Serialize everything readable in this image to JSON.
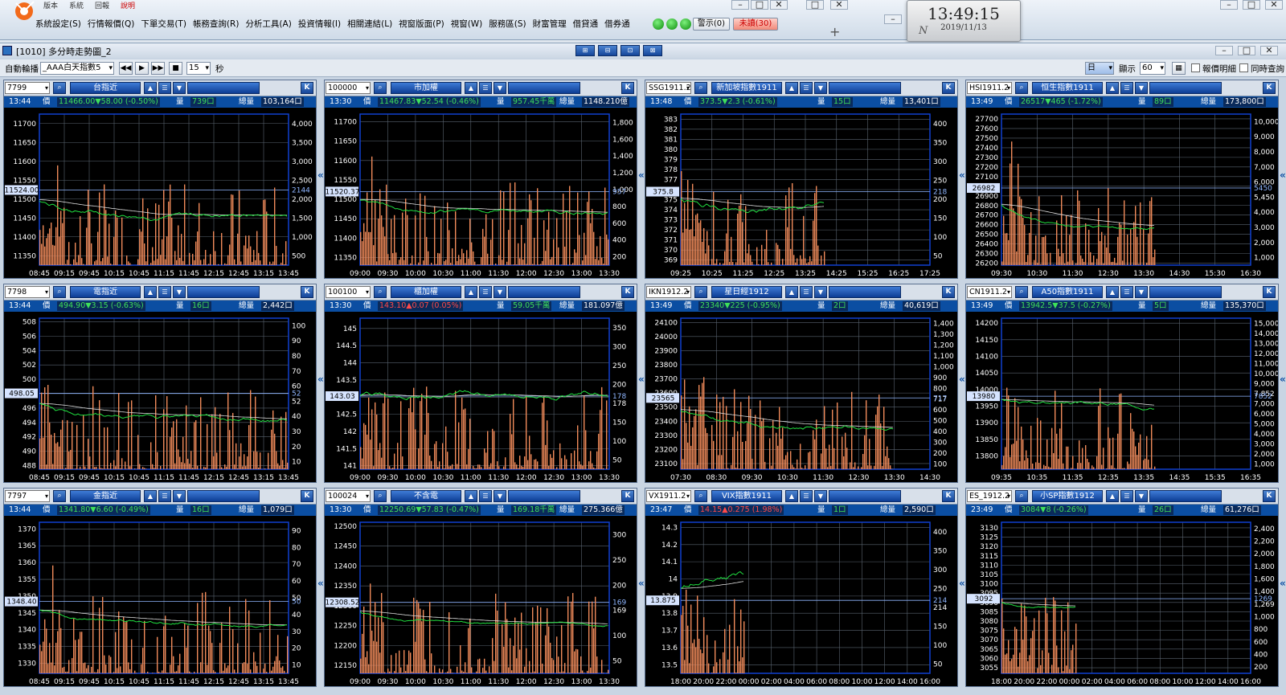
{
  "app": {
    "top_strip": [
      "版本",
      "系統",
      "回報",
      "說明"
    ],
    "menu": [
      "系統設定(S)",
      "行情報價(Q)",
      "下單交易(T)",
      "帳務查詢(R)",
      "分析工具(A)",
      "投資情報(I)",
      "相關連結(L)",
      "視窗版面(P)",
      "視窗(W)",
      "服務區(S)",
      "財富管理",
      "借貸通",
      "借券通"
    ],
    "alert_label": "警示(0)",
    "unread_label": "未讀(30)"
  },
  "clock": {
    "time": "13:49:15",
    "date": "2019/11/13",
    "mark": "N"
  },
  "window": {
    "title": "[1010] 多分時走勢圖_2",
    "title_buttons": [
      "⊞",
      "⊟",
      "⊡",
      "⊠"
    ]
  },
  "toolbar": {
    "auto_label": "自動輪播",
    "group": "_AAA白天指數5",
    "interval": "15",
    "sec": "秒",
    "period": "日",
    "display_label": "顯示",
    "display_value": "60",
    "opt1": "報價明細",
    "opt2": "同時查詢"
  },
  "labels": {
    "price": "價",
    "vol": "量",
    "total": "總量",
    "k": "K"
  },
  "panels": [
    {
      "code": "7799",
      "name": "台指近",
      "time": "13:44",
      "price": "11466.00▼58.00 (-0.50%)",
      "dir": "dn",
      "vol": "739口",
      "total": "103,164口",
      "yticks": [
        "11700",
        "11650",
        "11600",
        "11550",
        "11500",
        "11450",
        "11400",
        "11350"
      ],
      "ymin": 11325,
      "ymax": 11725,
      "vticks": [
        "4,000",
        "3,500",
        "3,000",
        "2,500",
        "2,000",
        "1,500",
        "1,000",
        "500"
      ],
      "vmax": 4200,
      "ref": "11524.00",
      "refv": 11524,
      "vref": "2144",
      "xticks": [
        "08:45",
        "09:15",
        "09:45",
        "10:15",
        "10:45",
        "11:15",
        "11:45",
        "12:15",
        "12:45",
        "13:15",
        "13:45"
      ],
      "fill": 1.0,
      "base": 11460,
      "amp": 25
    },
    {
      "code": "100000",
      "name": "市加權",
      "time": "13:30",
      "price": "11467.83▼52.54 (-0.46%)",
      "dir": "dn",
      "vol": "957.45千萬",
      "total": "1148.210億",
      "yticks": [
        "11700",
        "11650",
        "11600",
        "11550",
        "11500",
        "11450",
        "11400",
        "11350"
      ],
      "ymin": 11330,
      "ymax": 11720,
      "vticks": [
        "1,800",
        "1,600",
        "1,400",
        "1,200",
        "1,000",
        "800",
        "600",
        "400",
        "200"
      ],
      "vmax": 1900,
      "ref": "11520.37",
      "refv": 11520,
      "vref": "957",
      "xticks": [
        "09:00",
        "09:30",
        "10:00",
        "10:30",
        "11:00",
        "11:30",
        "12:00",
        "12:30",
        "13:00",
        "13:30"
      ],
      "fill": 1.0,
      "base": 11470,
      "amp": 20
    },
    {
      "code": "SSG1911.2",
      "name": "新加坡指數1911",
      "time": "13:48",
      "price": "373.5▼2.3 (-0.61%)",
      "dir": "dn",
      "vol": "15口",
      "total": "13,401口",
      "yticks": [
        "383",
        "382",
        "381",
        "380",
        "379",
        "378",
        "377",
        "376",
        "375",
        "374",
        "373",
        "372",
        "371",
        "370",
        "369"
      ],
      "ymin": 368.5,
      "ymax": 383.5,
      "vticks": [
        "400",
        "350",
        "300",
        "250",
        "200",
        "150",
        "100",
        "50"
      ],
      "vmax": 420,
      "ref": "375.8",
      "refv": 375.8,
      "vref": "218",
      "xticks": [
        "09:25",
        "10:25",
        "11:25",
        "12:25",
        "13:25",
        "14:25",
        "15:25",
        "16:25",
        "17:25"
      ],
      "fill": 0.58,
      "base": 374.2,
      "amp": 1.2
    },
    {
      "code": "HSI1911.2",
      "name": "恒生指數1911",
      "time": "13:49",
      "price": "26517▼465 (-1.72%)",
      "dir": "dn",
      "vol": "89口",
      "total": "173,800口",
      "yticks": [
        "27700",
        "27600",
        "27500",
        "27400",
        "27300",
        "27200",
        "27100",
        "27000",
        "26900",
        "26800",
        "26700",
        "26600",
        "26500",
        "26400",
        "26300",
        "26200"
      ],
      "ymin": 26180,
      "ymax": 27750,
      "vticks": [
        "10,000",
        "9,000",
        "8,000",
        "7,000",
        "6,000",
        "5,450",
        "4,000",
        "3,000",
        "2,000",
        "1,000"
      ],
      "vmax": 10500,
      "ref": "26982",
      "refv": 26982,
      "vref": "5450",
      "xticks": [
        "09:30",
        "10:30",
        "11:30",
        "12:30",
        "13:30",
        "14:30",
        "15:30",
        "16:30"
      ],
      "fill": 0.62,
      "base": 26560,
      "amp": 60
    },
    {
      "code": "7798",
      "name": "電指近",
      "time": "13:44",
      "price": "494.90▼3.15 (-0.63%)",
      "dir": "dn",
      "vol": "16口",
      "total": "2,442口",
      "yticks": [
        "508",
        "506",
        "504",
        "502",
        "500",
        "498",
        "496",
        "494",
        "492",
        "490",
        "488"
      ],
      "ymin": 487.5,
      "ymax": 508.5,
      "vticks": [
        "100",
        "90",
        "80",
        "70",
        "60",
        "52",
        "40",
        "30",
        "20",
        "10"
      ],
      "vmax": 105,
      "ref": "498.05",
      "refv": 498.05,
      "vref": "52",
      "xticks": [
        "08:45",
        "09:15",
        "09:45",
        "10:15",
        "10:45",
        "11:15",
        "11:45",
        "12:15",
        "12:45",
        "13:15",
        "13:45"
      ],
      "fill": 1.0,
      "base": 494.5,
      "amp": 1.2
    },
    {
      "code": "100100",
      "name": "櫃加權",
      "time": "13:30",
      "price": "143.10▲0.07 (0.05%)",
      "dir": "up",
      "vol": "59.05千萬",
      "total": "181.097億",
      "yticks": [
        "145",
        "144.5",
        "144",
        "143.5",
        "143",
        "142.5",
        "142",
        "141.5",
        "141"
      ],
      "ymin": 140.9,
      "ymax": 145.3,
      "vticks": [
        "350",
        "300",
        "250",
        "200",
        "178",
        "150",
        "100",
        "50"
      ],
      "vmax": 360,
      "ref": "143.03",
      "refv": 143.03,
      "vref": "178",
      "xticks": [
        "09:00",
        "09:30",
        "10:00",
        "10:30",
        "11:00",
        "11:30",
        "12:00",
        "12:30",
        "13:00",
        "13:30"
      ],
      "fill": 1.0,
      "base": 143.1,
      "amp": 0.3
    },
    {
      "code": "IKN1912.2",
      "name": "星日經1912",
      "time": "13:49",
      "price": "23340▼225 (-0.95%)",
      "dir": "dn",
      "vol": "2口",
      "total": "40,619口",
      "yticks": [
        "24100",
        "24000",
        "23900",
        "23800",
        "23700",
        "23600",
        "23500",
        "23400",
        "23300",
        "23200",
        "23100"
      ],
      "ymin": 23060,
      "ymax": 24130,
      "vticks": [
        "1,400",
        "1,300",
        "1,200",
        "1,100",
        "1,000",
        "900",
        "800",
        "717",
        "600",
        "500",
        "400",
        "300",
        "200",
        "100"
      ],
      "vmax": 1450,
      "ref": "23565",
      "refv": 23565,
      "vref": "717",
      "xticks": [
        "07:30",
        "08:30",
        "09:30",
        "10:30",
        "11:30",
        "12:30",
        "13:30",
        "14:30"
      ],
      "fill": 0.86,
      "base": 23360,
      "amp": 60
    },
    {
      "code": "CN1911.2",
      "name": "A50指數1911",
      "time": "13:49",
      "price": "13942.5▼37.5 (-0.27%)",
      "dir": "dn",
      "vol": "5口",
      "total": "135,370口",
      "yticks": [
        "14200",
        "14150",
        "14100",
        "14050",
        "14000",
        "13950",
        "13900",
        "13850",
        "13800"
      ],
      "ymin": 13760,
      "ymax": 14215,
      "vticks": [
        "15,000",
        "14,000",
        "13,000",
        "12,000",
        "11,000",
        "10,000",
        "9,000",
        "7,852",
        "7,000",
        "6,000",
        "5,000",
        "4,000",
        "3,000",
        "2,000",
        "1,000"
      ],
      "vmax": 15500,
      "ref": "13980",
      "refv": 13980,
      "vref": "7852",
      "xticks": [
        "09:35",
        "10:35",
        "11:35",
        "12:35",
        "13:35",
        "14:35",
        "15:35",
        "16:35"
      ],
      "fill": 0.62,
      "base": 13955,
      "amp": 25
    },
    {
      "code": "7797",
      "name": "金指近",
      "time": "13:44",
      "price": "1341.80▼6.60 (-0.49%)",
      "dir": "dn",
      "vol": "16口",
      "total": "1,079口",
      "yticks": [
        "1370",
        "1365",
        "1360",
        "1355",
        "1350",
        "1345",
        "1340",
        "1335",
        "1330"
      ],
      "ymin": 1327,
      "ymax": 1372,
      "vticks": [
        "90",
        "80",
        "70",
        "60",
        "50",
        "40",
        "30",
        "20",
        "10"
      ],
      "vmax": 98,
      "ref": "1348.40",
      "refv": 1348.4,
      "vref": "50",
      "xticks": [
        "08:45",
        "09:15",
        "09:45",
        "10:15",
        "10:45",
        "11:15",
        "11:45",
        "12:15",
        "12:45",
        "13:15",
        "13:45"
      ],
      "fill": 1.0,
      "base": 1342,
      "amp": 2
    },
    {
      "code": "100024",
      "name": "不含電",
      "time": "13:30",
      "price": "12250.69▼57.83 (-0.47%)",
      "dir": "dn",
      "vol": "169.18千萬",
      "total": "275.366億",
      "yticks": [
        "12500",
        "12450",
        "12400",
        "12350",
        "12300",
        "12250",
        "12200",
        "12150"
      ],
      "ymin": 12130,
      "ymax": 12510,
      "vticks": [
        "300",
        "250",
        "200",
        "169",
        "100",
        "50"
      ],
      "vmax": 320,
      "ref": "12308.52",
      "refv": 12308.52,
      "vref": "169",
      "xticks": [
        "09:00",
        "09:30",
        "10:00",
        "10:30",
        "11:00",
        "11:30",
        "12:00",
        "12:30",
        "13:00",
        "13:30"
      ],
      "fill": 1.0,
      "base": 12255,
      "amp": 12
    },
    {
      "code": "VX1911.2",
      "name": "VIX指數1911",
      "time": "23:47",
      "price": "14.15▲0.275 (1.98%)",
      "dir": "up",
      "vol": "1口",
      "total": "2,590口",
      "yticks": [
        "14.3",
        "14.2",
        "14.1",
        "14",
        "13.9",
        "13.8",
        "13.7",
        "13.6",
        "13.5"
      ],
      "ymin": 13.45,
      "ymax": 14.33,
      "vticks": [
        "400",
        "350",
        "300",
        "250",
        "214",
        "150",
        "100",
        "50"
      ],
      "vmax": 420,
      "ref": "13.875",
      "refv": 13.875,
      "vref": "214",
      "xticks": [
        "18:00",
        "20:00",
        "22:00",
        "00:00",
        "02:00",
        "04:00",
        "06:00",
        "08:00",
        "10:00",
        "12:00",
        "14:00",
        "16:00"
      ],
      "fill": 0.26,
      "base": 14.05,
      "amp": 0.08
    },
    {
      "code": "ES_1912.2",
      "name": "小SP指數1912",
      "time": "23:49",
      "price": "3084▼8 (-0.26%)",
      "dir": "dn",
      "vol": "26口",
      "total": "61,276口",
      "yticks": [
        "3130",
        "3125",
        "3120",
        "3115",
        "3110",
        "3105",
        "3100",
        "3095",
        "3090",
        "3085",
        "3080",
        "3075",
        "3070",
        "3065",
        "3060",
        "3055"
      ],
      "ymin": 3052,
      "ymax": 3133,
      "vticks": [
        "2,400",
        "2,200",
        "2,000",
        "1,800",
        "1,600",
        "1,400",
        "1,269",
        "1,000",
        "800",
        "600",
        "400",
        "200"
      ],
      "vmax": 2500,
      "ref": "3092",
      "refv": 3092,
      "vref": "1269",
      "xticks": [
        "18:00",
        "20:00",
        "22:00",
        "00:00",
        "02:00",
        "04:00",
        "06:00",
        "08:00",
        "10:00",
        "12:00",
        "14:00",
        "16:00"
      ],
      "fill": 0.3,
      "base": 3087,
      "amp": 2
    }
  ],
  "colors": {
    "up": "#ff3030",
    "down": "#20e040",
    "volume": "#f08a5a",
    "grid": "#5a6470",
    "axis": "#1040d0",
    "ref": "#8fb6ff",
    "avg": "#dddddd"
  }
}
